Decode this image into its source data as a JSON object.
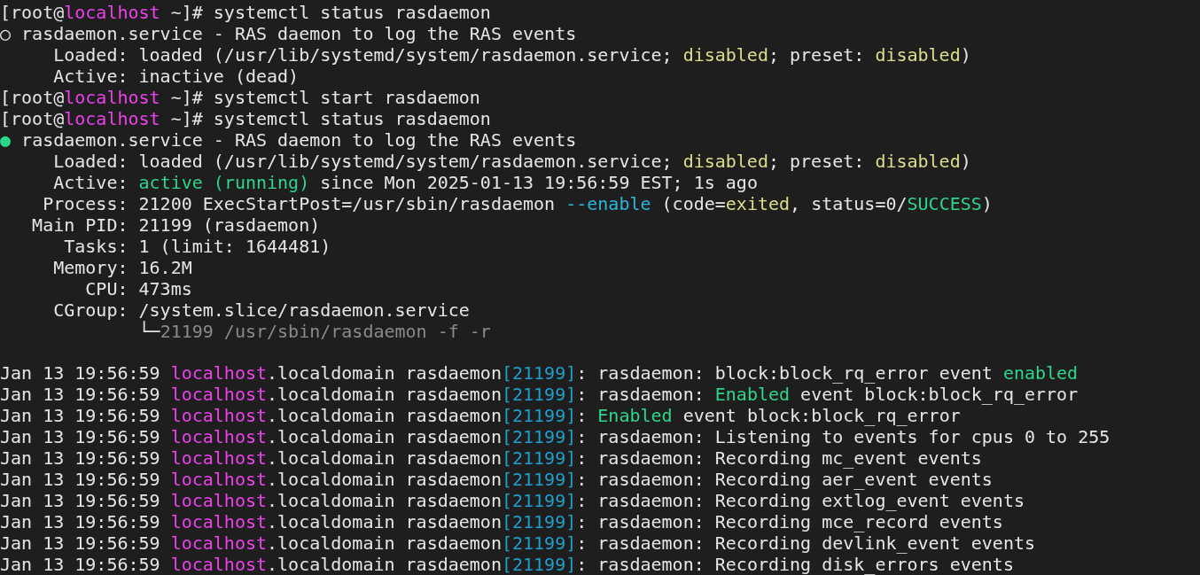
{
  "terminal": {
    "lines": [
      {
        "kind": "text",
        "segments": [
          {
            "text": "[root@"
          },
          {
            "text": "localhost",
            "color": "#f040f0"
          },
          {
            "text": " ~]# systemctl status rasdaemon"
          }
        ]
      },
      {
        "kind": "text",
        "segments": [
          {
            "text": "○ rasdaemon.service - RAS daemon to log the RAS events"
          }
        ]
      },
      {
        "kind": "text",
        "segments": [
          {
            "text": "     Loaded: loaded (/usr/lib/systemd/system/rasdaemon.service; "
          },
          {
            "text": "disabled",
            "color": "#dede8a"
          },
          {
            "text": "; preset: "
          },
          {
            "text": "disabled",
            "color": "#dede8a"
          },
          {
            "text": ")"
          }
        ]
      },
      {
        "kind": "text",
        "segments": [
          {
            "text": "     Active: inactive (dead)"
          }
        ]
      },
      {
        "kind": "text",
        "segments": [
          {
            "text": "[root@"
          },
          {
            "text": "localhost",
            "color": "#f040f0"
          },
          {
            "text": " ~]# systemctl start rasdaemon"
          }
        ]
      },
      {
        "kind": "text",
        "segments": [
          {
            "text": "[root@"
          },
          {
            "text": "localhost",
            "color": "#f040f0"
          },
          {
            "text": " ~]# systemctl status rasdaemon"
          }
        ]
      },
      {
        "kind": "text",
        "segments": [
          {
            "text": "●",
            "color": "#2ed68a"
          },
          {
            "text": " rasdaemon.service - RAS daemon to log the RAS events"
          }
        ]
      },
      {
        "kind": "text",
        "segments": [
          {
            "text": "     Loaded: loaded (/usr/lib/systemd/system/rasdaemon.service; "
          },
          {
            "text": "disabled",
            "color": "#dede8a"
          },
          {
            "text": "; preset: "
          },
          {
            "text": "disabled",
            "color": "#dede8a"
          },
          {
            "text": ")"
          }
        ]
      },
      {
        "kind": "text",
        "segments": [
          {
            "text": "     Active: "
          },
          {
            "text": "active (running)",
            "color": "#2ed68a"
          },
          {
            "text": " since Mon 2025-01-13 19:56:59 EST; 1s ago"
          }
        ]
      },
      {
        "kind": "text",
        "segments": [
          {
            "text": "    Process: 21200 ExecStartPost=/usr/sbin/rasdaemon "
          },
          {
            "text": "--enable",
            "color": "#29b8db"
          },
          {
            "text": " (code="
          },
          {
            "text": "exited",
            "color": "#dede8a"
          },
          {
            "text": ", status=0/"
          },
          {
            "text": "SUCCESS",
            "color": "#2ed68a"
          },
          {
            "text": ")"
          }
        ]
      },
      {
        "kind": "text",
        "segments": [
          {
            "text": "   Main PID: 21199 (rasdaemon)"
          }
        ]
      },
      {
        "kind": "text",
        "segments": [
          {
            "text": "      Tasks: 1 (limit: 1644481)"
          }
        ]
      },
      {
        "kind": "text",
        "segments": [
          {
            "text": "     Memory: 16.2M"
          }
        ]
      },
      {
        "kind": "text",
        "segments": [
          {
            "text": "        CPU: 473ms"
          }
        ]
      },
      {
        "kind": "text",
        "segments": [
          {
            "text": "     CGroup: /system.slice/rasdaemon.service"
          }
        ]
      },
      {
        "kind": "text",
        "segments": [
          {
            "text": "             └─"
          },
          {
            "text": "21199 /usr/sbin/rasdaemon -f -r",
            "color": "#8a8a8a"
          }
        ]
      },
      {
        "kind": "blank"
      },
      {
        "kind": "text",
        "segments": [
          {
            "text": "Jan 13 19:56:59 "
          },
          {
            "text": "localhost",
            "color": "#f040f0"
          },
          {
            "text": ".localdomain rasdaemon"
          },
          {
            "text": "[21199]",
            "color": "#1e9fcf"
          },
          {
            "text": ": rasdaemon: block:block_rq_error event "
          },
          {
            "text": "enabled",
            "color": "#2ed68a"
          }
        ]
      },
      {
        "kind": "text",
        "segments": [
          {
            "text": "Jan 13 19:56:59 "
          },
          {
            "text": "localhost",
            "color": "#f040f0"
          },
          {
            "text": ".localdomain rasdaemon"
          },
          {
            "text": "[21199]",
            "color": "#1e9fcf"
          },
          {
            "text": ": rasdaemon: "
          },
          {
            "text": "Enabled",
            "color": "#2ed68a"
          },
          {
            "text": " event block:block_rq_error"
          }
        ]
      },
      {
        "kind": "text",
        "segments": [
          {
            "text": "Jan 13 19:56:59 "
          },
          {
            "text": "localhost",
            "color": "#f040f0"
          },
          {
            "text": ".localdomain rasdaemon"
          },
          {
            "text": "[21199]",
            "color": "#1e9fcf"
          },
          {
            "text": ": "
          },
          {
            "text": "Enabled",
            "color": "#2ed68a"
          },
          {
            "text": " event block:block_rq_error"
          }
        ]
      },
      {
        "kind": "text",
        "segments": [
          {
            "text": "Jan 13 19:56:59 "
          },
          {
            "text": "localhost",
            "color": "#f040f0"
          },
          {
            "text": ".localdomain rasdaemon"
          },
          {
            "text": "[21199]",
            "color": "#1e9fcf"
          },
          {
            "text": ": rasdaemon: Listening to events for cpus 0 to 255"
          }
        ]
      },
      {
        "kind": "text",
        "segments": [
          {
            "text": "Jan 13 19:56:59 "
          },
          {
            "text": "localhost",
            "color": "#f040f0"
          },
          {
            "text": ".localdomain rasdaemon"
          },
          {
            "text": "[21199]",
            "color": "#1e9fcf"
          },
          {
            "text": ": rasdaemon: Recording mc_event events"
          }
        ]
      },
      {
        "kind": "text",
        "segments": [
          {
            "text": "Jan 13 19:56:59 "
          },
          {
            "text": "localhost",
            "color": "#f040f0"
          },
          {
            "text": ".localdomain rasdaemon"
          },
          {
            "text": "[21199]",
            "color": "#1e9fcf"
          },
          {
            "text": ": rasdaemon: Recording aer_event events"
          }
        ]
      },
      {
        "kind": "text",
        "segments": [
          {
            "text": "Jan 13 19:56:59 "
          },
          {
            "text": "localhost",
            "color": "#f040f0"
          },
          {
            "text": ".localdomain rasdaemon"
          },
          {
            "text": "[21199]",
            "color": "#1e9fcf"
          },
          {
            "text": ": rasdaemon: Recording extlog_event events"
          }
        ]
      },
      {
        "kind": "text",
        "segments": [
          {
            "text": "Jan 13 19:56:59 "
          },
          {
            "text": "localhost",
            "color": "#f040f0"
          },
          {
            "text": ".localdomain rasdaemon"
          },
          {
            "text": "[21199]",
            "color": "#1e9fcf"
          },
          {
            "text": ": rasdaemon: Recording mce_record events"
          }
        ]
      },
      {
        "kind": "text",
        "segments": [
          {
            "text": "Jan 13 19:56:59 "
          },
          {
            "text": "localhost",
            "color": "#f040f0"
          },
          {
            "text": ".localdomain rasdaemon"
          },
          {
            "text": "[21199]",
            "color": "#1e9fcf"
          },
          {
            "text": ": rasdaemon: Recording devlink_event events"
          }
        ]
      },
      {
        "kind": "text",
        "segments": [
          {
            "text": "Jan 13 19:56:59 "
          },
          {
            "text": "localhost",
            "color": "#f040f0"
          },
          {
            "text": ".localdomain rasdaemon"
          },
          {
            "text": "[21199]",
            "color": "#1e9fcf"
          },
          {
            "text": ": rasdaemon: Recording disk_errors events"
          }
        ]
      }
    ]
  }
}
